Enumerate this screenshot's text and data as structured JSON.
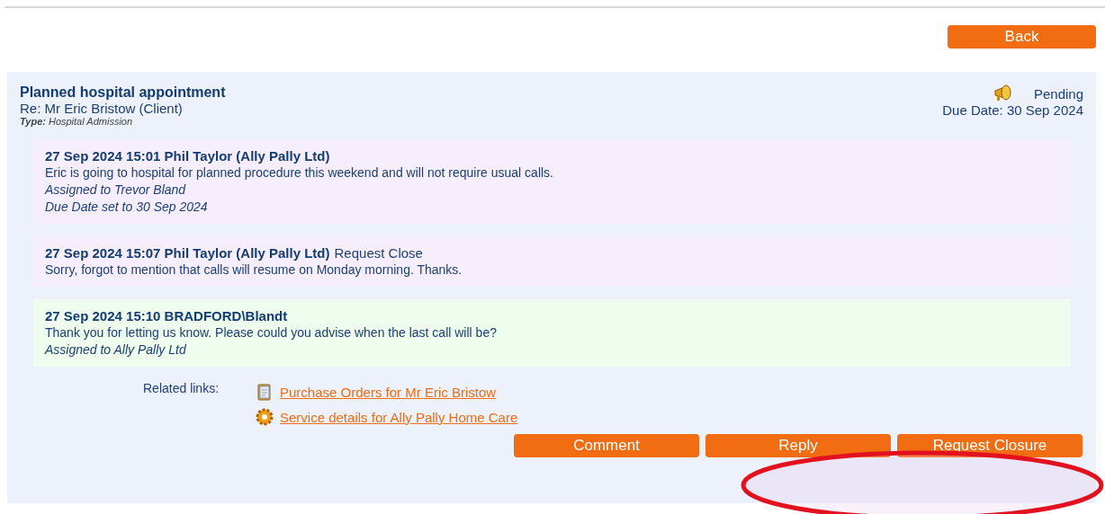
{
  "back_button": "Back",
  "task": {
    "title": "Planned hospital appointment",
    "regarding": "Re: Mr Eric Bristow (Client)",
    "type_label": "Type:",
    "type_value": "Hospital Admission",
    "status": "Pending",
    "due_date": "Due Date: 30 Sep 2024"
  },
  "messages": [
    {
      "kind": "external",
      "header": "27 Sep 2024 15:01 Phil Taylor (Ally Pally Ltd)",
      "lines": [
        {
          "kind": "body",
          "text": "Eric is going to hospital for planned procedure this weekend and will not require usual calls."
        },
        {
          "kind": "note",
          "text": "Assigned to Trevor Bland"
        },
        {
          "kind": "note",
          "text": "Due Date set to 30 Sep 2024"
        }
      ]
    },
    {
      "kind": "external",
      "header": "27 Sep 2024 15:07 Phil Taylor (Ally Pally Ltd)",
      "action": "Request Close",
      "lines": [
        {
          "kind": "body",
          "text": "Sorry, forgot to mention that calls will resume on Monday morning. Thanks."
        }
      ]
    },
    {
      "kind": "internal",
      "header": "27 Sep 2024 15:10 BRADFORD\\Blandt",
      "lines": [
        {
          "kind": "body",
          "text": "Thank you for letting us know. Please could you advise when the last call will be?"
        },
        {
          "kind": "note",
          "text": "Assigned to Ally Pally Ltd"
        }
      ]
    }
  ],
  "related_links": {
    "label": "Related links:",
    "links": [
      {
        "kind": "orders",
        "text": "Purchase Orders for Mr Eric Bristow"
      },
      {
        "kind": "service",
        "text": "Service details for Ally Pally Home Care"
      }
    ]
  },
  "actions": [
    "Comment",
    "Reply",
    "Request Closure"
  ]
}
